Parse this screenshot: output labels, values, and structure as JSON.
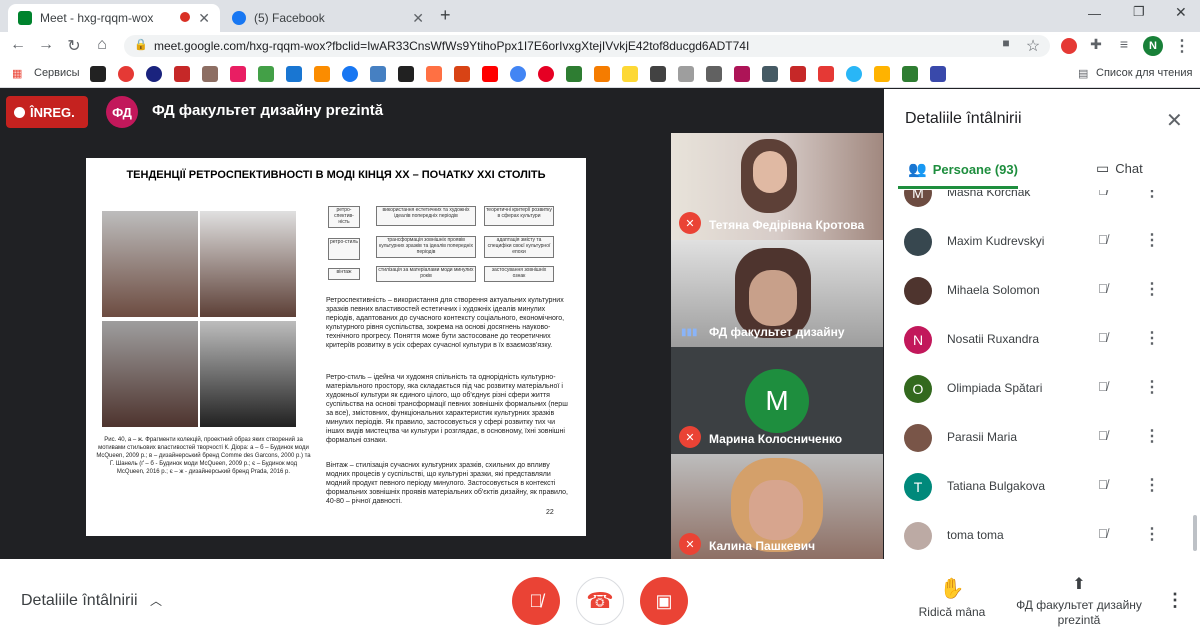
{
  "tabs": [
    {
      "title": "Meet - hxg-rqqm-wox",
      "active": true
    },
    {
      "title": "(5) Facebook",
      "active": false
    }
  ],
  "address": {
    "url": "meet.google.com/hxg-rqqm-wox?fbclid=IwAR33CnsWfWs9YtihoPpx1I7E6orIvxgXtejIVvkjE42tof8ducgd6ADT74I"
  },
  "bookmarks": {
    "services": "Сервисы",
    "reading_list": "Список для чтения"
  },
  "profile_initial": "N",
  "meeting": {
    "recording": "ÎNREG.",
    "presenter_initials": "ФД",
    "presenter_title": "ФД факультет дизайну prezintă"
  },
  "slide": {
    "title": "ТЕНДЕНЦІЇ РЕТРОСПЕКТИВНОСТІ В МОДІ КІНЦЯ ХХ – ПОЧАТКУ ХХІ СТОЛІТЬ",
    "caption": "Рис. 40, а – ж. Фрагменти колекцій, проектний образ яких створений за мотивами стильових властивостей творчості К. Діора: а – б – Будинок моди McQueen, 2009 р.; в – дизайнерський бренд Comme des Garcons, 2000 р.) та Г. Шанель (ґ – б - Будинок моди McQueen, 2009 р.; є – Будинок мод McQueen, 2016 р.; є – ж - дизайнерський бренд Prada, 2016 р.",
    "para1": "Ретроспективність – використання для створення актуальних культурних зразків певних властивостей естетичних і художніх ідеалів минулих періодів, адаптованих до сучасного контексту соціального, економічного, культурного рівня суспільства, зокрема на основі досягнень науково-технічного прогресу. Поняття може бути застосоване до теоретичних критеріїв розвитку в усіх сферах сучасної культури в їх взаємозв'язку.",
    "para2": "Ретро-стиль – ідейна чи художня спільність та однорідність культурно-матеріального простору, яка складається під час розвитку матеріальної і художньої культури як єдиного цілого, що об'єднує різні сфери життя суспільства на основі трансформації певних зовнішніх формальних (перш за все), змістовних, функціональних характеристик культурних зразків минулих періодів. Як правило, застосовується у сфері розвитку тих чи інших видів мистецтва чи культури і розглядає, в основному, їхні зовнішні формальні ознаки.",
    "para3": "Вінтаж – стилізація сучасних культурних зразків, схильних до впливу модних процесів у суспільстві, що культурні зразки, які представляли модний продукт певного періоду минулого. Застосовується в контексті формальних зовнішніх проявів матеріальних об'єктів дизайну, як правило, 40-80 – річної давності.",
    "page": "22",
    "diagram": [
      "ретро-спектив-ність",
      "ретро-стиль",
      "вінтаж",
      "використання естетичних та художніх ідеалів попередніх періодів",
      "теоретичні критерії розвитку в сферах культури",
      "трансформація зовнішніх проявів культурних зразків та ідеалів попередніх періодів",
      "адаптація змісту та специфіки своєї культурної епохи",
      "стилізація за матеріалами моди минулих років",
      "застосування зовнішніх ознак"
    ]
  },
  "participants_tiles": [
    {
      "name": "Тетяна Федірівна Кротова",
      "muted": true
    },
    {
      "name": "ФД факультет дизайну",
      "muted": false
    },
    {
      "name": "Марина Колосниченко",
      "initial": "M",
      "muted": true
    },
    {
      "name": "Калина Пашкевич",
      "muted": true
    }
  ],
  "panel": {
    "title": "Detaliile întâlnirii",
    "tab_people": "Persoane (93)",
    "tab_chat": "Chat",
    "people": [
      {
        "name": "Masha Korchak",
        "initial": "M",
        "color": "#6d4c41"
      },
      {
        "name": "Maxim Kudrevskyi",
        "initial": "",
        "color": "#37474f"
      },
      {
        "name": "Mihaela Solomon",
        "initial": "",
        "color": "#4e342e"
      },
      {
        "name": "Nosatii Ruxandra",
        "initial": "N",
        "color": "#c2185b"
      },
      {
        "name": "Olimpiada Spătari",
        "initial": "O",
        "color": "#33691e"
      },
      {
        "name": "Parasii Maria",
        "initial": "",
        "color": "#795548"
      },
      {
        "name": "Tatiana Bulgakova",
        "initial": "T",
        "color": "#00897b"
      },
      {
        "name": "toma toma",
        "initial": "",
        "color": "#bcaaa4"
      }
    ]
  },
  "bottom": {
    "details": "Detaliile întâlnirii",
    "raise_hand": "Ridică mâna",
    "presenting": "ФД факультет дизайну prezintă"
  },
  "colors": {
    "record": "#c5221f",
    "danger": "#ea4335",
    "accent": "#1e8e3e"
  }
}
